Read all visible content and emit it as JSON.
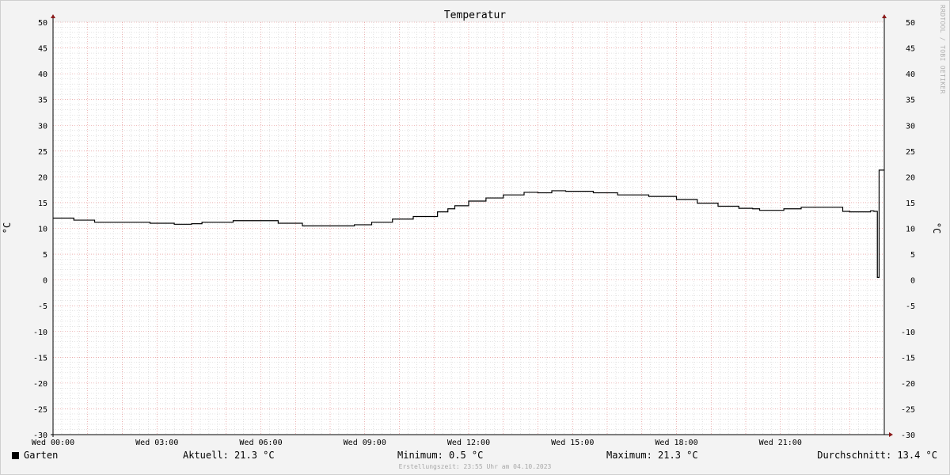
{
  "chart_data": {
    "type": "line",
    "title": "Temperatur",
    "ylabel": "°C",
    "ylim": [
      -30,
      50
    ],
    "yticks": [
      "50",
      "45",
      "40",
      "35",
      "30",
      "25",
      "20",
      "15",
      "10",
      "5",
      "0",
      "-5",
      "-10",
      "-15",
      "-20",
      "-25",
      "-30"
    ],
    "xlim": [
      0,
      24
    ],
    "xticks": [
      {
        "v": 0,
        "label": "Wed 00:00"
      },
      {
        "v": 3,
        "label": "Wed 03:00"
      },
      {
        "v": 6,
        "label": "Wed 06:00"
      },
      {
        "v": 9,
        "label": "Wed 09:00"
      },
      {
        "v": 12,
        "label": "Wed 12:00"
      },
      {
        "v": 15,
        "label": "Wed 15:00"
      },
      {
        "v": 18,
        "label": "Wed 18:00"
      },
      {
        "v": 21,
        "label": "Wed 21:00"
      }
    ],
    "series": [
      {
        "name": "Garten",
        "color": "#000000",
        "x": [
          0,
          0.5,
          0.6,
          1.2,
          2.5,
          2.8,
          3.5,
          4.0,
          4.3,
          5.2,
          6.5,
          7.2,
          7.5,
          8.3,
          8.7,
          9.2,
          9.8,
          10.4,
          11.0,
          11.1,
          11.4,
          11.6,
          12.0,
          12.5,
          13.0,
          13.6,
          14.0,
          14.4,
          14.8,
          15.6,
          16.3,
          17.2,
          18.0,
          18.6,
          19.2,
          19.8,
          20.2,
          20.4,
          21.1,
          21.6,
          22.5,
          22.8,
          23.0,
          23.5,
          23.6,
          23.7,
          23.8,
          23.85,
          24.0
        ],
        "y": [
          12.0,
          12.0,
          11.6,
          11.2,
          11.2,
          11.0,
          10.8,
          10.9,
          11.2,
          11.5,
          11.0,
          10.5,
          10.5,
          10.5,
          10.7,
          11.2,
          11.8,
          12.3,
          12.3,
          13.2,
          13.8,
          14.4,
          15.3,
          15.9,
          16.5,
          17.0,
          16.9,
          17.3,
          17.2,
          16.9,
          16.5,
          16.2,
          15.6,
          14.9,
          14.3,
          13.9,
          13.8,
          13.5,
          13.8,
          14.1,
          14.1,
          13.3,
          13.2,
          13.2,
          13.4,
          13.3,
          0.5,
          21.3,
          21.3
        ]
      }
    ]
  },
  "legend": {
    "series_name": "Garten",
    "current": "Aktuell: 21.3 °C",
    "minimum": "Minimum: 0.5 °C",
    "maximum": "Maximum: 21.3 °C",
    "average": "Durchschnitt: 13.4 °C"
  },
  "footer_note": "Erstellungszeit: 23:55 Uhr am 04.10.2023",
  "watermark": "RRDTOOL / TOBI OETIKER",
  "colors": {
    "grid_major": "#e08080",
    "grid_minor": "#c8c8c8",
    "axis": "#000000",
    "arrow": "#8b1a1a",
    "canvas": "#ffffff"
  }
}
